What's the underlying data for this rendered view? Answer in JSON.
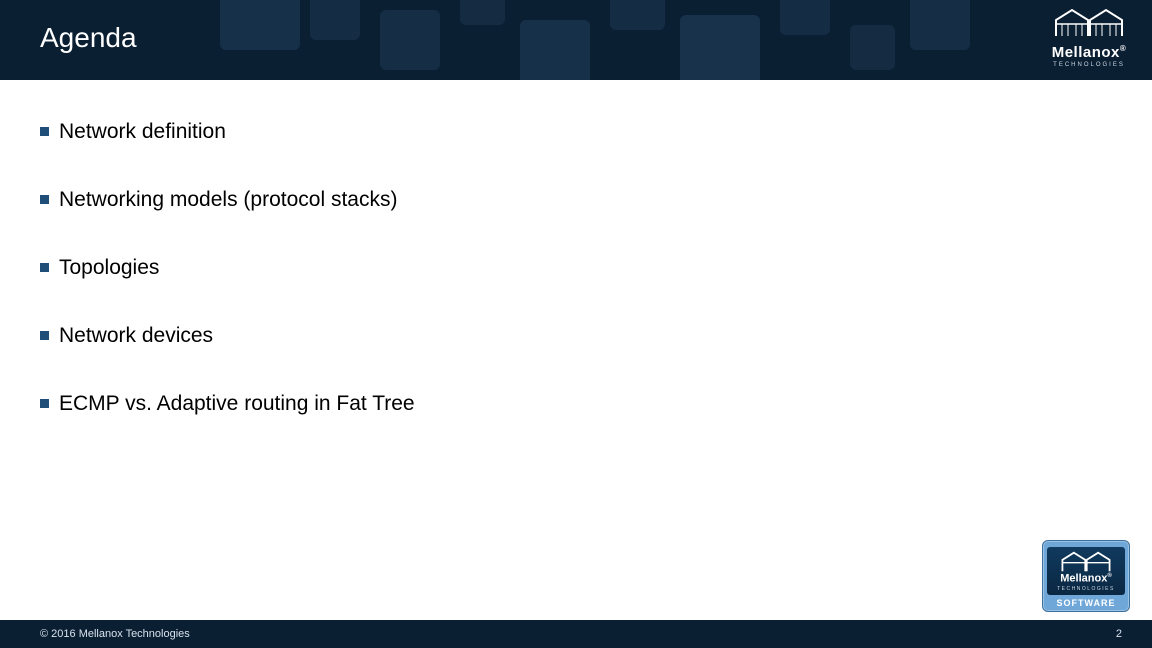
{
  "header": {
    "title": "Agenda"
  },
  "logo": {
    "brand": "Mellanox",
    "tagline": "TECHNOLOGIES"
  },
  "bullets": [
    "Network definition",
    "Networking models (protocol stacks)",
    "Topologies",
    "Network devices",
    "ECMP vs. Adaptive routing in Fat Tree"
  ],
  "badge": {
    "brand": "Mellanox",
    "tagline": "TECHNOLOGIES",
    "label": "SOFTWARE"
  },
  "footer": {
    "copyright": "© 2016 Mellanox Technologies",
    "page": "2"
  }
}
